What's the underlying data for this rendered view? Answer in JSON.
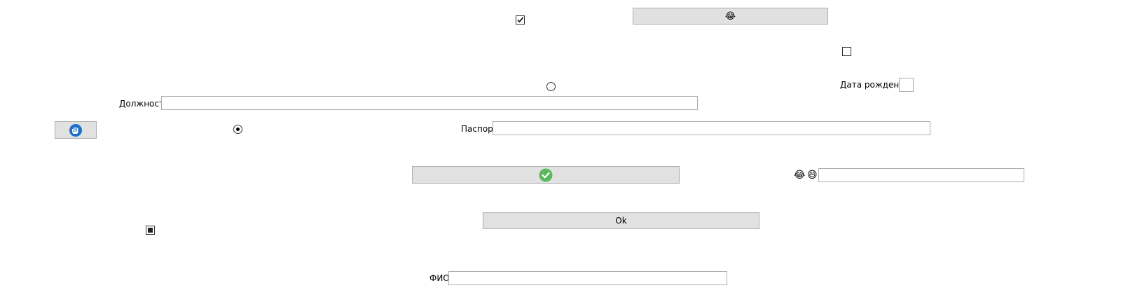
{
  "form": {
    "birth_date_label": "Дата рождения",
    "position_label": "Должность",
    "passport_label": "Паспорт",
    "fio_label": "ФИО",
    "ok_button_label": "Ok",
    "emoji_button_glyph": "😂",
    "emoji_label_1": "😂",
    "emoji_label_2": "😄",
    "birth_date_value": "",
    "position_value": "",
    "passport_value": "",
    "emoji_field_value": "",
    "fio_value": ""
  },
  "state": {
    "checkbox_top_checked": true,
    "checkbox_right_checked": false,
    "checkbox_left_indeterminate": true,
    "radio_middle_selected": false,
    "radio_left_selected": true
  },
  "colors": {
    "button_face": "#e1e1e1",
    "button_border": "#adadad",
    "field_border": "#abadb3",
    "check_green": "#5cb85c",
    "hand_icon_blue": "#1e6fc6"
  }
}
